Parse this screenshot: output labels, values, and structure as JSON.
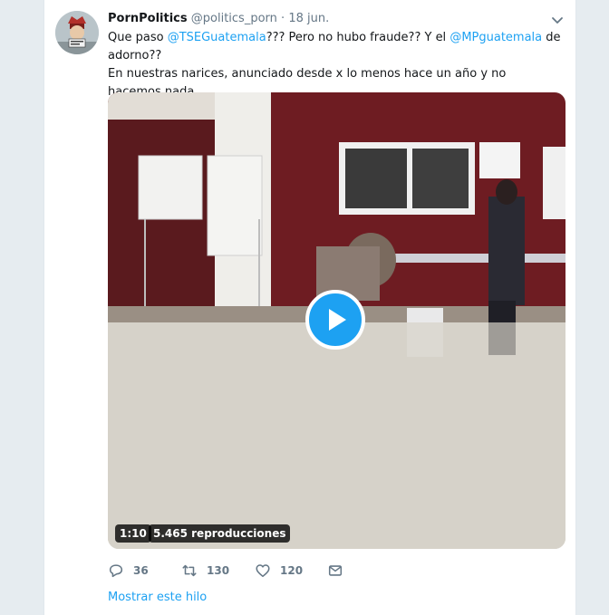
{
  "tweet": {
    "display_name": "PornPolitics",
    "handle": "@politics_porn",
    "separator": "·",
    "date": "18 jun.",
    "text_part1": "Que paso ",
    "mention1": "@TSEGuatemala",
    "text_part2": "??? Pero no hubo fraude?? Y el ",
    "mention2": "@MPguatemala",
    "text_part3": " de adorno??",
    "text_line2": "En nuestras narices, anunciado desde x lo menos hace un año y no hacemos nada"
  },
  "video": {
    "duration": "1:10",
    "views": "5.465 reproducciones"
  },
  "actions": {
    "replies": "36",
    "retweets": "130",
    "likes": "120"
  },
  "show_thread": "Mostrar este hilo",
  "colors": {
    "accent": "#1da1f2",
    "muted": "#657786",
    "background": "#e6ecf0"
  }
}
